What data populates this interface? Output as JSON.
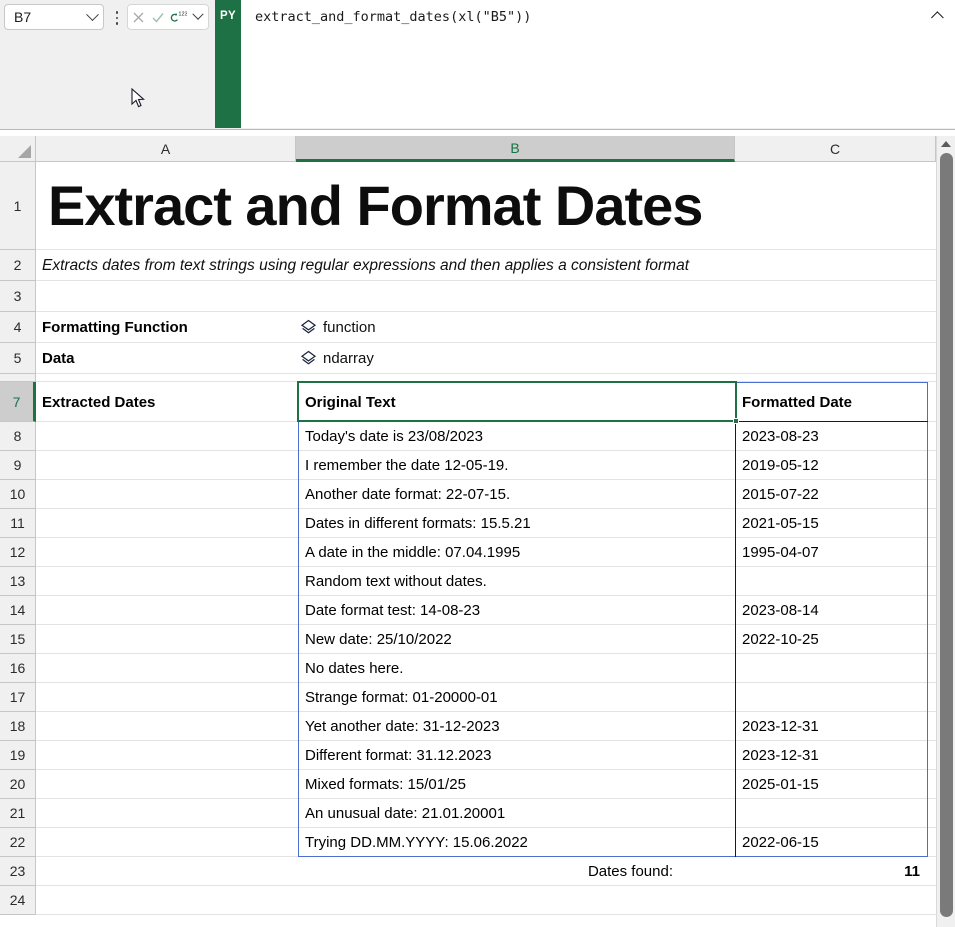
{
  "formula_bar": {
    "name_box_value": "B7",
    "name_box_icon": "chevron-down-icon",
    "more_options_icon": "kebab-menu-icon",
    "cancel_icon": "close-icon",
    "enter_icon": "checkmark-icon",
    "function_icon": "refresh-123-icon",
    "function_dropdown_icon": "chevron-down-icon",
    "python_badge": "PY",
    "formula": "extract_and_format_dates(xl(\"B5\"))",
    "collapse_icon": "chevron-up-icon",
    "accent_green": "#1e7145"
  },
  "grid": {
    "columns": [
      {
        "label": "A",
        "selected": false
      },
      {
        "label": "B",
        "selected": true
      },
      {
        "label": "C",
        "selected": false
      }
    ],
    "rows": [
      {
        "label": "1",
        "selected": false
      },
      {
        "label": "2",
        "selected": false
      },
      {
        "label": "3",
        "selected": false
      },
      {
        "label": "4",
        "selected": false
      },
      {
        "label": "5",
        "selected": false
      },
      {
        "label": "7",
        "selected": true
      },
      {
        "label": "8",
        "selected": false
      },
      {
        "label": "9",
        "selected": false
      },
      {
        "label": "10",
        "selected": false
      },
      {
        "label": "11",
        "selected": false
      },
      {
        "label": "12",
        "selected": false
      },
      {
        "label": "13",
        "selected": false
      },
      {
        "label": "14",
        "selected": false
      },
      {
        "label": "15",
        "selected": false
      },
      {
        "label": "16",
        "selected": false
      },
      {
        "label": "17",
        "selected": false
      },
      {
        "label": "18",
        "selected": false
      },
      {
        "label": "19",
        "selected": false
      },
      {
        "label": "20",
        "selected": false
      },
      {
        "label": "21",
        "selected": false
      },
      {
        "label": "22",
        "selected": false
      },
      {
        "label": "23",
        "selected": false
      },
      {
        "label": "24",
        "selected": false
      }
    ],
    "select_all_icon": "select-all-triangle-icon",
    "scrollbar_up_icon": "scroll-up-arrow-icon"
  },
  "sheet": {
    "title": "Extract and Format Dates",
    "subtitle": "Extracts dates from text strings using regular expressions and then applies a consistent format",
    "labels": {
      "formatting_function": "Formatting Function",
      "data": "Data",
      "extracted_dates": "Extracted Dates",
      "dates_found": "Dates found:"
    },
    "python_objects": {
      "formatting_function_value": "function",
      "data_value": "ndarray",
      "icon": "python-object-card-icon"
    },
    "dates_found_count": "11",
    "table": {
      "headers": [
        "Original Text",
        "Formatted Date"
      ],
      "rows": [
        {
          "original": "Today's date is 23/08/2023",
          "formatted": "2023-08-23"
        },
        {
          "original": "I remember the date 12-05-19.",
          "formatted": "2019-05-12"
        },
        {
          "original": "Another date format: 22-07-15.",
          "formatted": "2015-07-22"
        },
        {
          "original": "Dates in different formats: 15.5.21",
          "formatted": "2021-05-15"
        },
        {
          "original": "A date in the middle: 07.04.1995",
          "formatted": "1995-04-07"
        },
        {
          "original": "Random text without dates.",
          "formatted": ""
        },
        {
          "original": "Date format test: 14-08-23",
          "formatted": "2023-08-14"
        },
        {
          "original": "New date: 25/10/2022",
          "formatted": "2022-10-25"
        },
        {
          "original": "No dates here.",
          "formatted": ""
        },
        {
          "original": "Strange format: 01-20000-01",
          "formatted": ""
        },
        {
          "original": "Yet another date: 31-12-2023",
          "formatted": "2023-12-31"
        },
        {
          "original": "Different format: 31.12.2023",
          "formatted": "2023-12-31"
        },
        {
          "original": "Mixed formats: 15/01/25",
          "formatted": "2025-01-15"
        },
        {
          "original": "An unusual date: 21.01.20001",
          "formatted": ""
        },
        {
          "original": "Trying DD.MM.YYYY: 15.06.2022",
          "formatted": "2022-06-15"
        }
      ]
    }
  }
}
